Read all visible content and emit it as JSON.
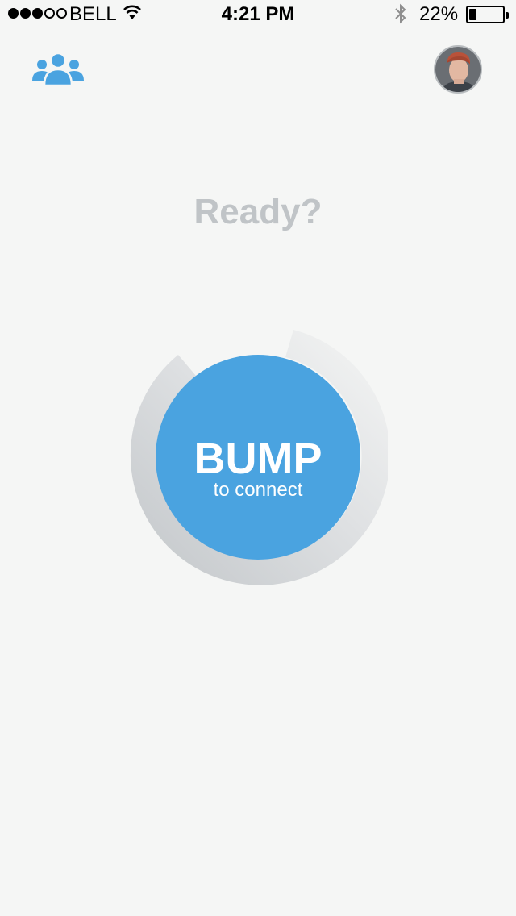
{
  "status_bar": {
    "carrier": "BELL",
    "signal_bars_filled": 3,
    "signal_bars_total": 5,
    "time": "4:21 PM",
    "battery_percent": "22%",
    "battery_level": 0.22,
    "icons": [
      "signal-icon",
      "wifi-icon",
      "bluetooth-icon",
      "battery-icon"
    ]
  },
  "header": {
    "contacts_icon": "people-group-icon",
    "avatar_icon": "user-avatar"
  },
  "main": {
    "prompt": "Ready?",
    "bump_title": "BUMP",
    "bump_subtitle": "to connect"
  },
  "colors": {
    "accent": "#4aa3e0",
    "background": "#f5f6f5",
    "ring": "#c3c7ca",
    "muted_text": "#c0c4c7"
  }
}
